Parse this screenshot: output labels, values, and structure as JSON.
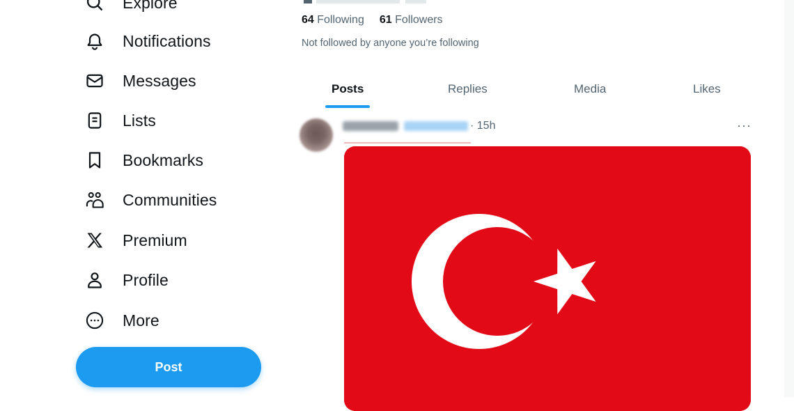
{
  "sidebar": {
    "items": [
      {
        "label": "Explore",
        "icon": "search-icon"
      },
      {
        "label": "Notifications",
        "icon": "bell-icon"
      },
      {
        "label": "Messages",
        "icon": "envelope-icon"
      },
      {
        "label": "Lists",
        "icon": "list-icon"
      },
      {
        "label": "Bookmarks",
        "icon": "bookmark-icon"
      },
      {
        "label": "Communities",
        "icon": "communities-icon"
      },
      {
        "label": "Premium",
        "icon": "x-logo-icon"
      },
      {
        "label": "Profile",
        "icon": "person-icon"
      },
      {
        "label": "More",
        "icon": "more-circle-icon"
      }
    ],
    "post_button": "Post"
  },
  "profile": {
    "following_count": "64",
    "following_label": "Following",
    "followers_count": "61",
    "followers_label": "Followers",
    "not_followed_text": "Not followed by anyone you’re following"
  },
  "tabs": [
    {
      "label": "Posts",
      "active": true
    },
    {
      "label": "Replies",
      "active": false
    },
    {
      "label": "Media",
      "active": false
    },
    {
      "label": "Likes",
      "active": false
    }
  ],
  "post": {
    "time": "· 15h",
    "more": "···",
    "media": {
      "type": "turkish-flag",
      "color": "#e30a17"
    }
  },
  "colors": {
    "accent": "#1d9bf0",
    "text_primary": "#0f1419",
    "text_secondary": "#536471",
    "flag_red": "#e30a17"
  }
}
